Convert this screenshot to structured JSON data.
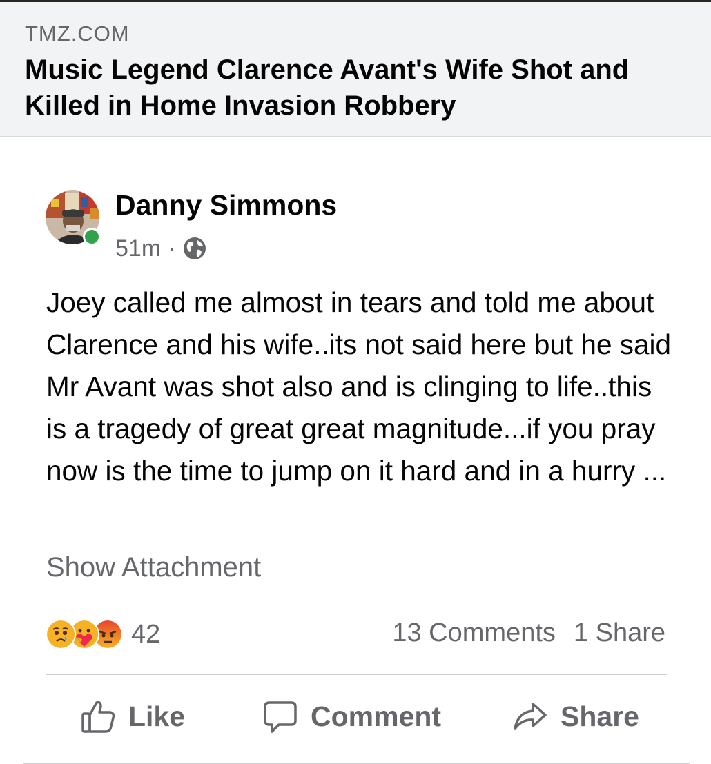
{
  "link_preview": {
    "domain": "TMZ.COM",
    "title": "Music Legend Clarence Avant's Wife Shot and Killed in Home Invasion Robbery"
  },
  "post": {
    "author": "Danny Simmons",
    "time": "51m",
    "separator": "·",
    "audience_icon": "globe-icon",
    "online": true,
    "text": "Joey called me almost in tears and told me about Clarence and his wife..its not said here but he said Mr Avant was shot also and is clinging to life..this is a tragedy of great great magnitude...if you pray now is the time to jump on it hard and in a hurry ...",
    "show_attachment": "Show Attachment"
  },
  "reactions": {
    "icons": [
      "sad-icon",
      "care-icon",
      "angry-icon"
    ],
    "count": "42",
    "comments": "13 Comments",
    "shares": "1 Share"
  },
  "actions": {
    "like": "Like",
    "comment": "Comment",
    "share": "Share"
  },
  "colors": {
    "secondary_text": "#65676b",
    "online_green": "#31a24c",
    "preview_bg": "#f2f3f5"
  }
}
